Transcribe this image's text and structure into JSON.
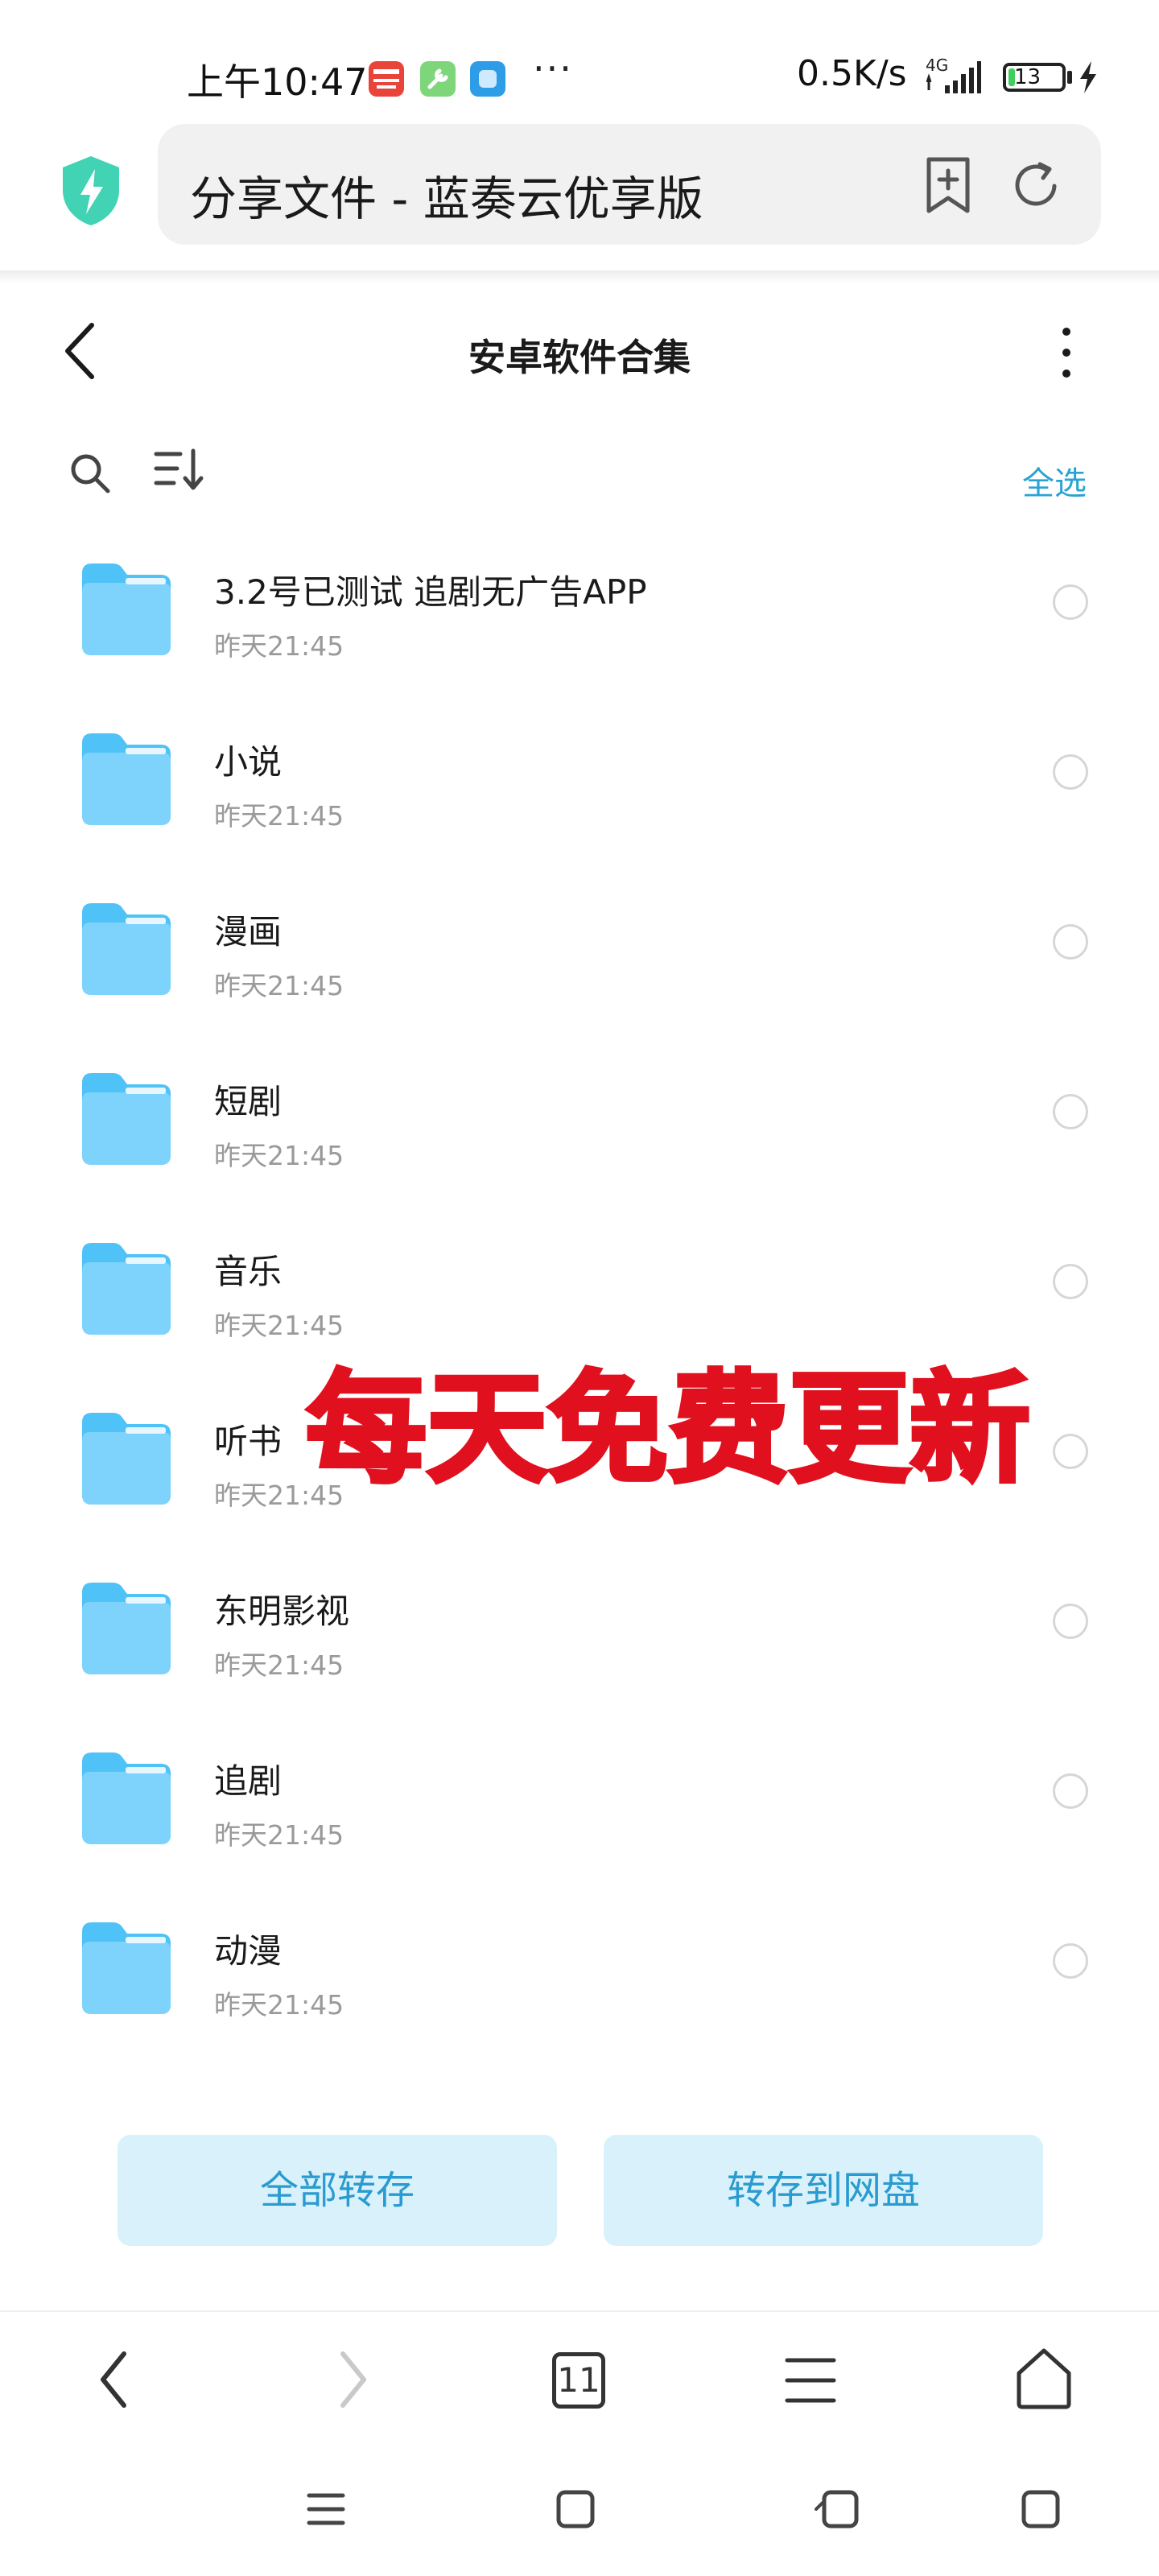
{
  "status_bar": {
    "time": "上午10:47",
    "dots": "···",
    "speed": "0.5K/s",
    "network": "4G",
    "battery_level": "13",
    "battery_fraction": 0.13,
    "app_icons": [
      "toutiao-icon",
      "tools-icon",
      "app-icon"
    ]
  },
  "browser": {
    "url_title": "分享文件 - 蓝奏云优享版",
    "shield_color": "#41d3b4"
  },
  "page": {
    "title": "安卓软件合集",
    "select_all": "全选"
  },
  "files": [
    {
      "name": "3.2号已测试 追剧无广告APP",
      "time": "昨天21:45"
    },
    {
      "name": "小说",
      "time": "昨天21:45"
    },
    {
      "name": "漫画",
      "time": "昨天21:45"
    },
    {
      "name": "短剧",
      "time": "昨天21:45"
    },
    {
      "name": "音乐",
      "time": "昨天21:45"
    },
    {
      "name": "听书",
      "time": "昨天21:45"
    },
    {
      "name": "东明影视",
      "time": "昨天21:45"
    },
    {
      "name": "追剧",
      "time": "昨天21:45"
    },
    {
      "name": "动漫",
      "time": "昨天21:45"
    }
  ],
  "overlay": {
    "text": "每天免费更新",
    "color": "#e0101e"
  },
  "actions": {
    "save_all": "全部转存",
    "save_to_disk": "转存到网盘"
  },
  "browser_nav": {
    "tab_count": "11"
  },
  "colors": {
    "accent": "#29a3d4",
    "button_bg": "#d9f1fb",
    "folder": "#4fc2f7"
  }
}
